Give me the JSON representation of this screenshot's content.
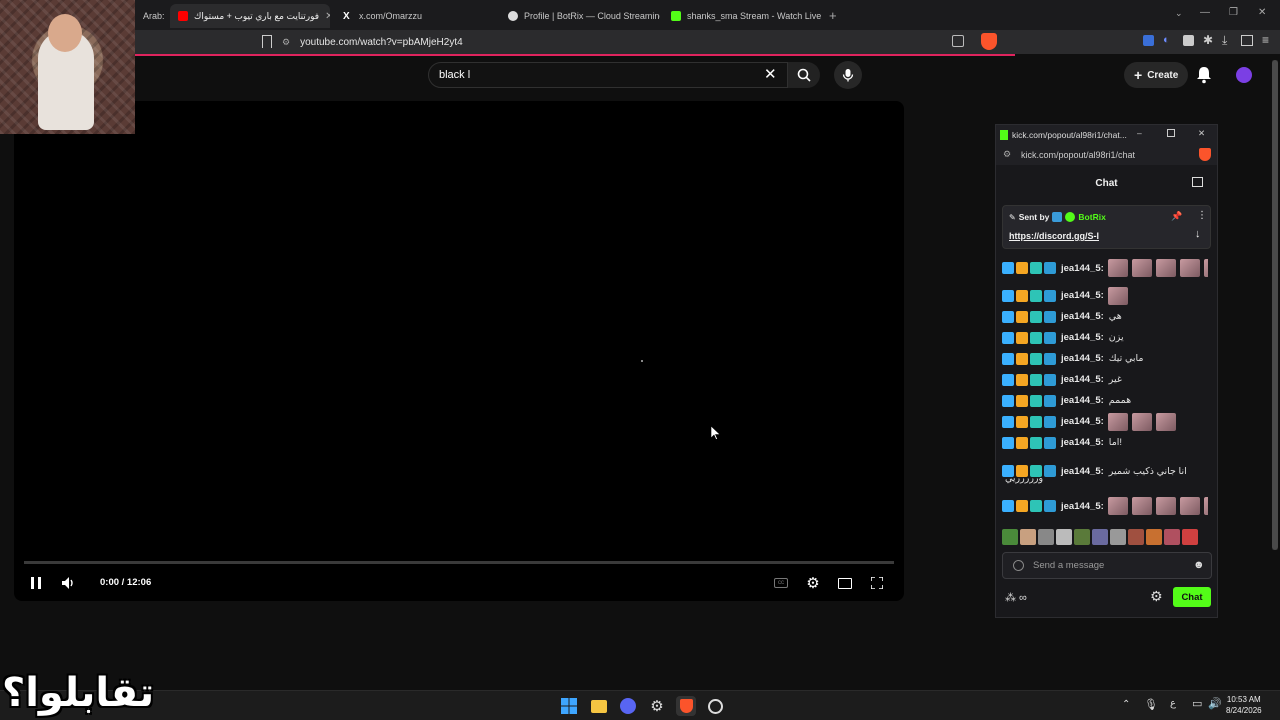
{
  "browser": {
    "tabs": [
      {
        "label": "Arab:",
        "favicon_color": "#666666"
      },
      {
        "label": "فورتنايت مع باري تيوب + مستواك",
        "favicon_color": "#ff0000",
        "active": true
      },
      {
        "label": "x.com/Omarzzu",
        "favicon_color": "#ffffff"
      },
      {
        "label": "Profile | BotRix — Cloud Streaming B",
        "favicon_color": "#ffffff"
      },
      {
        "label": "shanks_sma Stream - Watch Live on",
        "favicon_color": "#53fc18"
      }
    ],
    "url": "youtube.com/watch?v=pbAMjeH2yt4"
  },
  "youtube": {
    "search_value": "black l",
    "create_label": "Create"
  },
  "video": {
    "time": "0:00 / 12:06",
    "progress_fraction": 0
  },
  "kick": {
    "window_title": "kick.com/popout/al98ri1/chat...",
    "url": "kick.com/popout/al98ri1/chat",
    "chat_title": "Chat",
    "pinned": {
      "sent_by": "Sent by",
      "sender": "BotRix",
      "link": "https://discord.gg/S-I"
    },
    "messages": [
      {
        "user": "jea144_5:",
        "text": "",
        "emotes": 5
      },
      {
        "user": "jea144_5:",
        "text": "",
        "emotes": 1
      },
      {
        "user": "jea144_5:",
        "text": "هي",
        "emotes": 0
      },
      {
        "user": "jea144_5:",
        "text": "يزن",
        "emotes": 0
      },
      {
        "user": "jea144_5:",
        "text": "مابي تيك",
        "emotes": 0
      },
      {
        "user": "jea144_5:",
        "text": "غير",
        "emotes": 0
      },
      {
        "user": "jea144_5:",
        "text": "هممم",
        "emotes": 0
      },
      {
        "user": "jea144_5:",
        "text": "",
        "emotes": 3
      },
      {
        "user": "jea144_5:",
        "text": "اما!",
        "emotes": 0
      },
      {
        "user": "jea144_5:",
        "text": "انا جاني ذكيب شمير",
        "cont": "وررررريي",
        "emotes": 0
      },
      {
        "user": "jea144_5:",
        "text": "",
        "emotes": 5
      }
    ],
    "input_placeholder": "Send a message",
    "chat_button": "Chat"
  },
  "taskbar": {
    "time": "10:53 AM",
    "date": "8/24/2026",
    "lang": "ع"
  },
  "overlay_text": "تقابلوا؟"
}
